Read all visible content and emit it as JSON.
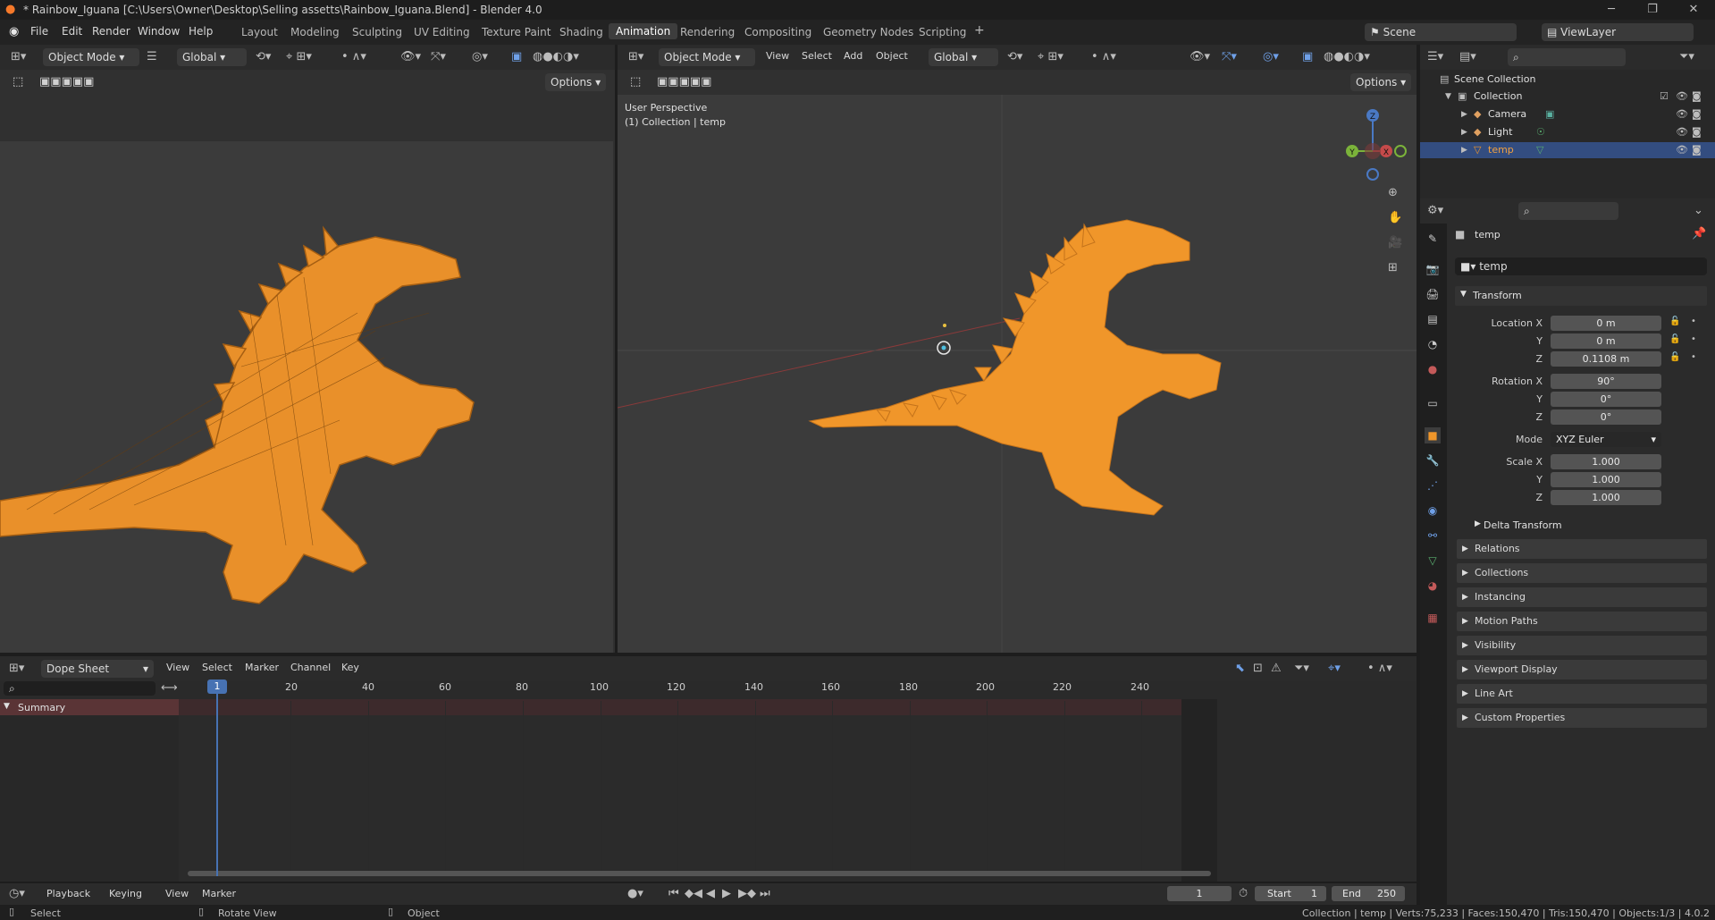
{
  "window": {
    "title": "* Rainbow_Iguana [C:\\Users\\Owner\\Desktop\\Selling assetts\\Rainbow_Iguana.Blend] - Blender 4.0"
  },
  "menus": [
    "File",
    "Edit",
    "Render",
    "Window",
    "Help"
  ],
  "workspaces": [
    "Layout",
    "Modeling",
    "Sculpting",
    "UV Editing",
    "Texture Paint",
    "Shading",
    "Animation",
    "Rendering",
    "Compositing",
    "Geometry Nodes",
    "Scripting"
  ],
  "active_workspace": "Animation",
  "scene": {
    "label": "Scene",
    "view_layer": "ViewLayer"
  },
  "left_viewport": {
    "mode": "Object Mode",
    "orientation": "Global",
    "options": "Options"
  },
  "right_viewport": {
    "mode": "Object Mode",
    "menus": [
      "View",
      "Select",
      "Add",
      "Object"
    ],
    "orientation": "Global",
    "options": "Options",
    "overlay_line1": "User Perspective",
    "overlay_line2": "(1) Collection | temp",
    "gizmo": {
      "z": "Z",
      "y": "Y",
      "x": "X"
    }
  },
  "outliner": {
    "scene_collection": "Scene Collection",
    "collection": "Collection",
    "items": [
      "Camera",
      "Light",
      "temp"
    ],
    "selected": "temp"
  },
  "properties": {
    "object_name": "temp",
    "data_name": "temp",
    "transform_label": "Transform",
    "location": {
      "label": "Location X",
      "x": "0 m",
      "y": "0 m",
      "z": "0.1108 m"
    },
    "rotation": {
      "label": "Rotation X",
      "x": "90°",
      "y": "0°",
      "z": "0°"
    },
    "mode_label": "Mode",
    "mode_value": "XYZ Euler",
    "scale": {
      "label": "Scale X",
      "x": "1.000",
      "y": "1.000",
      "z": "1.000"
    },
    "axis_y": "Y",
    "axis_z": "Z",
    "delta": "Delta Transform",
    "sections": [
      "Relations",
      "Collections",
      "Instancing",
      "Motion Paths",
      "Visibility",
      "Viewport Display",
      "Line Art",
      "Custom Properties"
    ]
  },
  "dopesheet": {
    "editor": "Dope Sheet",
    "menus": [
      "View",
      "Select",
      "Marker",
      "Channel",
      "Key"
    ],
    "summary": "Summary",
    "current_frame": "1",
    "ticks": [
      "20",
      "40",
      "60",
      "80",
      "100",
      "120",
      "140",
      "160",
      "180",
      "200",
      "220",
      "240"
    ]
  },
  "timeline": {
    "menus": [
      "Playback",
      "Keying",
      "View",
      "Marker"
    ],
    "frame": "1",
    "start_label": "Start",
    "start": "1",
    "end_label": "End",
    "end": "250"
  },
  "statusbar": {
    "select": "Select",
    "rotate": "Rotate View",
    "object": "Object",
    "stats": "Collection | temp | Verts:75,233 | Faces:150,470 | Tris:150,470 | Objects:1/3 | 4.0.2"
  },
  "colors": {
    "accent": "#4772b3",
    "object_orange": "#f0962a",
    "header": "#2b2b2b",
    "viewport_bg": "#3b3b3b"
  }
}
